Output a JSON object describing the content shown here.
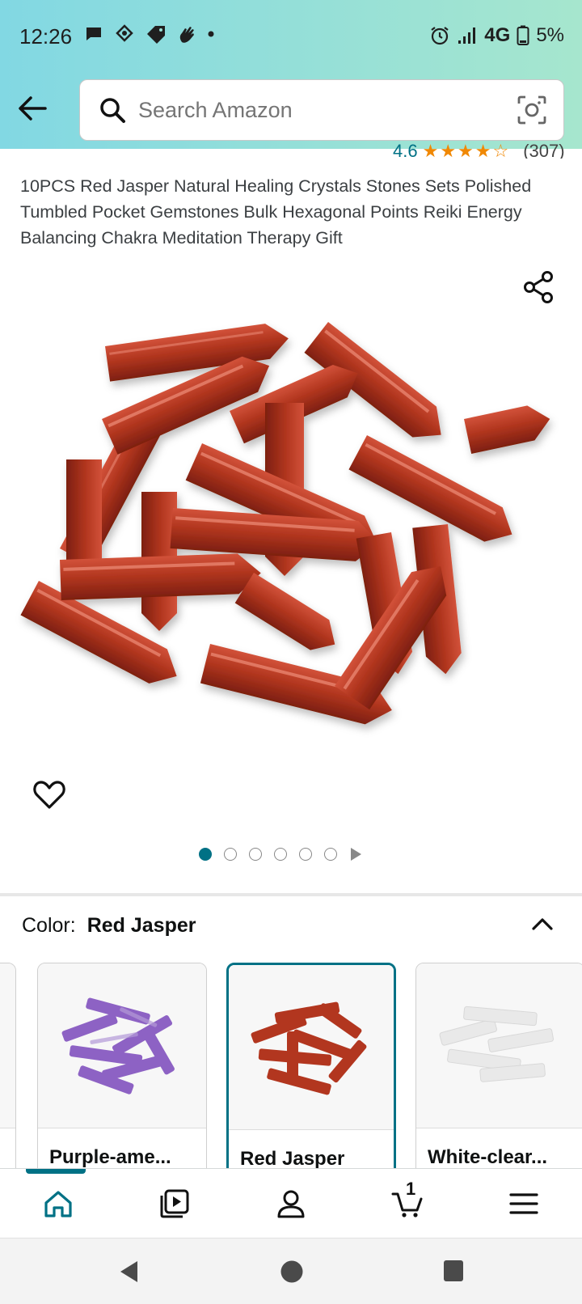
{
  "status_bar": {
    "time": "12:26",
    "network": "4G",
    "battery": "5%",
    "icons_left": [
      "chat-icon",
      "shield-icon",
      "tag-icon",
      "hand-icon",
      "dot-icon"
    ],
    "icons_right": [
      "alarm-icon",
      "signal-icon",
      "battery-icon"
    ]
  },
  "header": {
    "search_placeholder": "Search Amazon"
  },
  "product": {
    "rating_value": "4.6",
    "rating_stars": "★★★★☆",
    "review_count": "(307)",
    "title": "10PCS Red Jasper Natural Healing Crystals Stones Sets Polished Tumbled Pocket Gemstones Bulk Hexagonal Points Reiki Energy Balancing Chakra Meditation Therapy Gift",
    "image_dots_total": 6,
    "image_dots_active": 1
  },
  "color_selector": {
    "label": "Color:",
    "selected": "Red Jasper",
    "options": [
      {
        "name": "Purple-ame...",
        "color": "#8d62c4"
      },
      {
        "name": "Red Jasper",
        "color": "#b2361f"
      },
      {
        "name": "White-clear...",
        "color": "#e9e9e9"
      }
    ]
  },
  "bottom_nav": {
    "cart_count": "1",
    "items": [
      "home-icon",
      "video-icon",
      "account-icon",
      "cart-icon",
      "menu-icon"
    ]
  },
  "colors": {
    "accent": "#007185",
    "header_gradient_start": "#82d8e3",
    "header_gradient_end": "#a6e6ce",
    "star": "#f08804",
    "jasper": "#b2361f"
  }
}
